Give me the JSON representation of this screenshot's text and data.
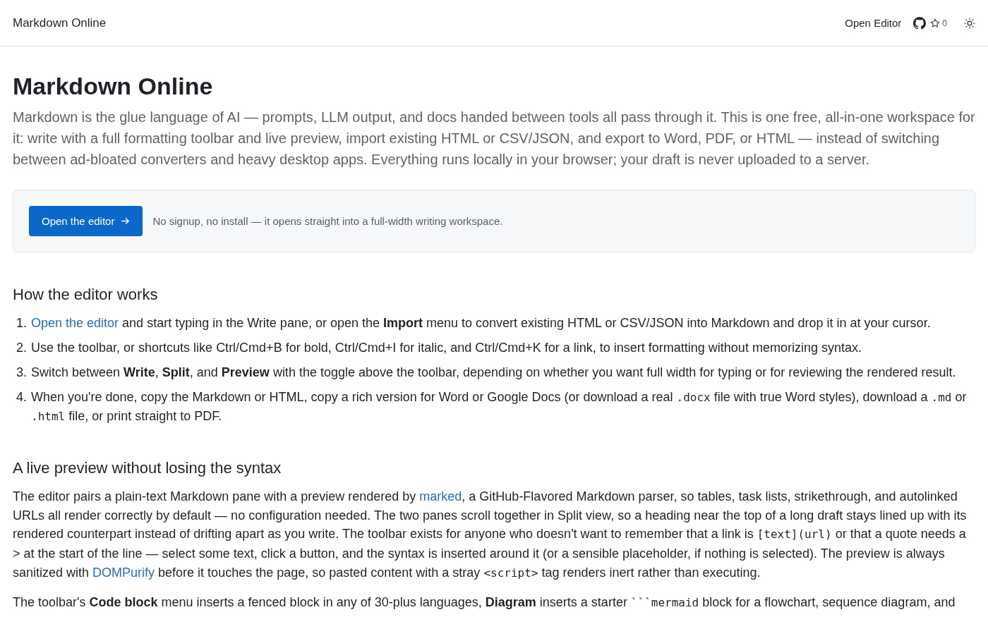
{
  "header": {
    "brand": "Markdown Online",
    "nav_link": "Open Editor",
    "star_count": "0"
  },
  "title": "Markdown Online",
  "intro": "Markdown is the glue language of AI — prompts, LLM output, and docs handed between tools all pass through it. This is one free, all-in-one workspace for it: write with a full formatting toolbar and live preview, import existing HTML or CSV/JSON, and export to Word, PDF, or HTML — instead of switching between ad-bloated converters and heavy desktop apps. Everything runs locally in your browser; your draft is never uploaded to a server.",
  "cta": {
    "button": "Open the editor",
    "note": "No signup, no install — it opens straight into a full-width writing workspace."
  },
  "sections": [
    {
      "heading": "How the editor works",
      "kind": "ordered_list",
      "items": [
        {
          "number": "1.",
          "segments": [
            {
              "kind": "link",
              "text": "Open the editor"
            },
            {
              "kind": "text",
              "text": " and start typing in the Write pane, or open the **Import** menu to convert existing HTML or CSV/JSON into Markdown and drop it in at your cursor."
            }
          ]
        },
        {
          "number": "2.",
          "segments": [
            {
              "kind": "text",
              "text": "Use the toolbar, or shortcuts like Ctrl/Cmd+B for bold, Ctrl/Cmd+I for italic, and Ctrl/Cmd+K for a link, to insert formatting without memorizing syntax."
            }
          ]
        },
        {
          "number": "3.",
          "segments": [
            {
              "kind": "text",
              "text": "Switch between **Write**, **Split**, and **Preview** with the toggle above the toolbar, depending on whether you want full width for typing or for reviewing the rendered result."
            }
          ]
        },
        {
          "number": "4.",
          "segments": [
            {
              "kind": "text",
              "text": "When you're done, copy the Markdown or HTML, copy a rich version for Word or Google Docs (or download a real "
            },
            {
              "kind": "code",
              "text": ".docx"
            },
            {
              "kind": "text",
              "text": " file with true Word styles), download a "
            },
            {
              "kind": "code",
              "text": ".md"
            },
            {
              "kind": "text",
              "text": " or "
            },
            {
              "kind": "code",
              "text": ".html"
            },
            {
              "kind": "text",
              "text": " file, or print straight to PDF."
            }
          ]
        }
      ]
    },
    {
      "heading": "A live preview without losing the syntax",
      "kind": "paragraphs",
      "paragraphs": [
        {
          "segments": [
            {
              "kind": "text",
              "text": "The editor pairs a plain-text Markdown pane with a preview rendered by "
            },
            {
              "kind": "link",
              "text": "marked"
            },
            {
              "kind": "text",
              "text": ", a GitHub-Flavored Markdown parser, so tables, task lists, strikethrough, and autolinked URLs all render correctly by default — no configuration needed. The two panes scroll together in Split view, so a heading near the top of a long draft stays lined up with its rendered counterpart instead of drifting apart as you write. The toolbar exists for anyone who doesn't want to remember that a link is "
            },
            {
              "kind": "code",
              "text": "[text](url)"
            },
            {
              "kind": "text",
              "text": " or that a quote needs a > at the start of the line — select some text, click a button, and the syntax is inserted around it (or a sensible placeholder, if nothing is selected). The preview is always sanitized with "
            },
            {
              "kind": "link",
              "text": "DOMPurify"
            },
            {
              "kind": "text",
              "text": " before it touches the page, so pasted content with a stray "
            },
            {
              "kind": "code",
              "text": "<script>"
            },
            {
              "kind": "text",
              "text": " tag renders inert rather than executing."
            }
          ]
        },
        {
          "segments": [
            {
              "kind": "text",
              "text": "The toolbar's **Code block** menu inserts a fenced block in any of 30-plus languages, **Diagram** inserts a starter "
            },
            {
              "kind": "code",
              "text": "```mermaid"
            },
            {
              "kind": "text",
              "text": " block for a flowchart, sequence diagram, and"
            }
          ]
        }
      ]
    }
  ]
}
